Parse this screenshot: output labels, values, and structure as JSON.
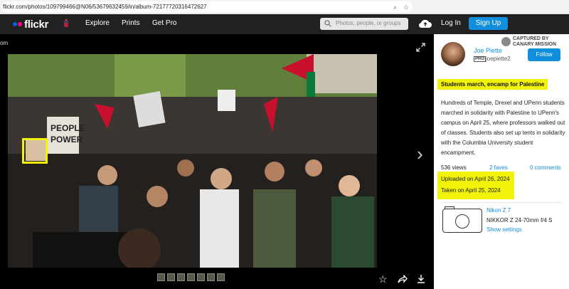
{
  "browser": {
    "url": "flickr.com/photos/109799466@N06/53679632459/in/album-72177720316472627"
  },
  "nav": {
    "logo": "flickr",
    "links": [
      "Explore",
      "Prints",
      "Get Pro"
    ],
    "search_placeholder": "Photos, people, or groups",
    "login": "Log In",
    "signup": "Sign Up"
  },
  "viewer": {
    "album_fragment": "om",
    "next_arrow": "›"
  },
  "owner": {
    "name": "Joe Piette",
    "pro_badge": "PRO",
    "handle": "joepiette2",
    "follow": "Follow",
    "captured_by": "CAPTURED BY CANARY MISSION"
  },
  "photo": {
    "title": "Students march, encamp for Palestine",
    "description": "Hundreds of Temple, Drexel and UPenn students marched in solidarity with Palestine to UPenn's campus on April 25, where professors walked out of classes. Students also set up tents in solidarity with the Columbia University student encampment.",
    "views": "536 views",
    "faves": "2 faves",
    "comments": "0 comments",
    "uploaded": "Uploaded on April 26, 2024",
    "taken": "Taken on April 25, 2024"
  },
  "camera": {
    "model": "Nikon Z 7",
    "lens": "NIKKOR Z 24-70mm f/4 S",
    "show_settings": "Show settings"
  },
  "colors": {
    "accent": "#128fdc",
    "highlight": "#f0f20a",
    "nav_bg": "#212124"
  }
}
